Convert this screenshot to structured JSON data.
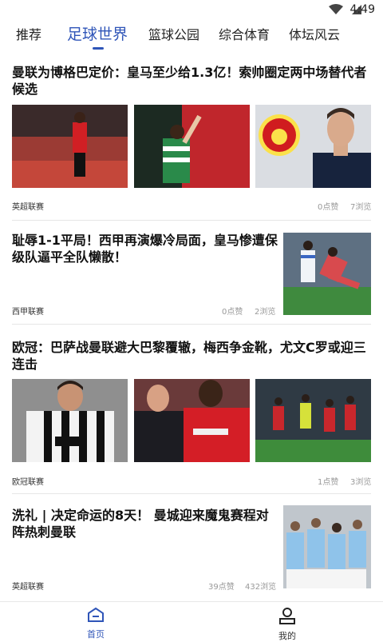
{
  "status": {
    "time": "4:49"
  },
  "tabs": [
    "推荐",
    "足球世界",
    "篮球公园",
    "综合体育",
    "体坛风云"
  ],
  "articles": [
    {
      "title": "曼联为博格巴定价：皇马至少给1.3亿！索帅圈定两中场替代者候选",
      "league": "英超联赛",
      "likes": "0点赞",
      "views": "7浏览"
    },
    {
      "title": "耻辱1-1平局！西甲再演爆冷局面，皇马惨遭保级队逼平全队懒散！",
      "league": "西甲联赛",
      "likes": "0点赞",
      "views": "2浏览"
    },
    {
      "title": "欧冠：巴萨战曼联避大巴黎覆辙，梅西争金靴，尤文C罗或迎三连击",
      "league": "欧冠联赛",
      "likes": "1点赞",
      "views": "3浏览"
    },
    {
      "title": "洗礼 | 决定命运的8天！ 曼城迎来魔鬼赛程对阵热刺曼联",
      "league": "英超联赛",
      "likes": "39点赞",
      "views": "432浏览"
    }
  ],
  "bottom_nav": [
    {
      "label": "首页",
      "icon": "home-icon"
    },
    {
      "label": "我的",
      "icon": "user-icon"
    }
  ],
  "colors": {
    "accent": "#2f55b8"
  }
}
